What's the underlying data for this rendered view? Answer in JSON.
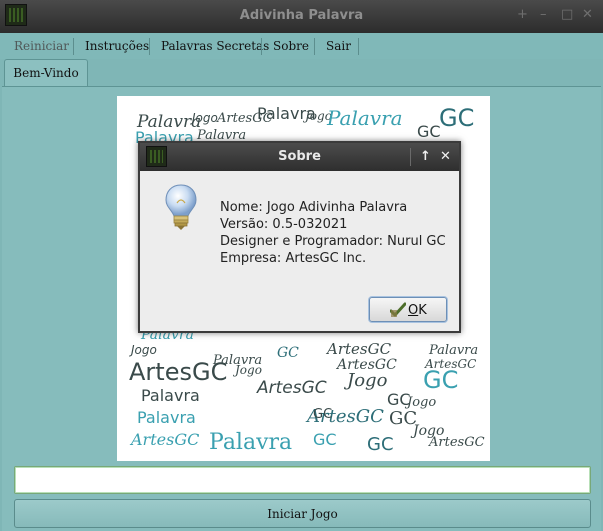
{
  "window": {
    "title": "Adivinha Palavra",
    "controls": {
      "pin": "+",
      "minimize": "–",
      "maximize": "□",
      "close": "✕"
    }
  },
  "menu": {
    "items": [
      {
        "label": "Reiniciar",
        "enabled": false
      },
      {
        "label": "Instruções",
        "enabled": true
      },
      {
        "label": "Palavras Secretas",
        "enabled": true
      },
      {
        "label": "Sobre",
        "enabled": true
      },
      {
        "label": "Sair",
        "enabled": true
      }
    ]
  },
  "tabs": [
    {
      "label": "Bem-Vindo",
      "active": true
    }
  ],
  "main": {
    "word_input": {
      "value": "",
      "placeholder": ""
    },
    "start_button": "Iniciar Jogo"
  },
  "wordcloud": {
    "words": [
      {
        "text": "Palavra",
        "color": "#3a4a4a"
      },
      {
        "text": "Jogo",
        "color": "#3a4a4a"
      },
      {
        "text": "ArtesGC",
        "color": "#3a4a4a"
      },
      {
        "text": "Palavra",
        "color": "#3a4a4a"
      },
      {
        "text": "Jogo",
        "color": "#3a4a4a"
      },
      {
        "text": "Palavra",
        "color": "#3aa0b0"
      },
      {
        "text": "GC",
        "color": "#2d6e78"
      },
      {
        "text": "GC",
        "color": "#3a4a4a"
      },
      {
        "text": "Palavra",
        "color": "#3aa0b0"
      },
      {
        "text": "Palavra",
        "color": "#3a4a4a"
      },
      {
        "text": "Palavra",
        "color": "#3aa0b0"
      },
      {
        "text": "Jogo",
        "color": "#3a4a4a"
      },
      {
        "text": "ArtesGC",
        "color": "#3a4a4a"
      },
      {
        "text": "Palavra",
        "color": "#3a4a4a"
      },
      {
        "text": "ArtesGC",
        "color": "#3a4a4a"
      },
      {
        "text": "ArtesGC",
        "color": "#3a4a4a"
      },
      {
        "text": "Palavra",
        "color": "#3a4a4a"
      },
      {
        "text": "ArtesGC",
        "color": "#3a4a4a"
      },
      {
        "text": "Jogo",
        "color": "#3a4a4a"
      },
      {
        "text": "GC",
        "color": "#2d6e78"
      },
      {
        "text": "GC",
        "color": "#3aa0b0"
      },
      {
        "text": "Palavra",
        "color": "#3a4a4a"
      },
      {
        "text": "Jogo",
        "color": "#3a4a4a"
      },
      {
        "text": "ArtesGC",
        "color": "#3a4a4a"
      },
      {
        "text": "Palavra",
        "color": "#3aa0b0"
      },
      {
        "text": "ArtesGC",
        "color": "#2d6e78"
      },
      {
        "text": "GC",
        "color": "#3a4a4a"
      },
      {
        "text": "GC",
        "color": "#3a4a4a"
      },
      {
        "text": "ArtesGC",
        "color": "#3aa0b0"
      },
      {
        "text": "Palavra",
        "color": "#3aa0b0"
      },
      {
        "text": "GC",
        "color": "#3aa0b0"
      },
      {
        "text": "GC",
        "color": "#2d6e78"
      },
      {
        "text": "ArtesGC",
        "color": "#3a4a4a"
      },
      {
        "text": "Jogo",
        "color": "#3a4a4a"
      },
      {
        "text": "Jogo",
        "color": "#3a4a4a"
      },
      {
        "text": "GC",
        "color": "#3a4a4a"
      }
    ]
  },
  "dialog": {
    "title": "Sobre",
    "controls": {
      "pin": "↑",
      "close": "✕"
    },
    "lines": [
      "Nome: Jogo Adivinha Palavra",
      "Versão: 0.5-032021",
      "Designer e Programador: Nurul GC",
      "Empresa: ArtesGC Inc."
    ],
    "ok_mnemonic": "O",
    "ok_rest": "K"
  }
}
